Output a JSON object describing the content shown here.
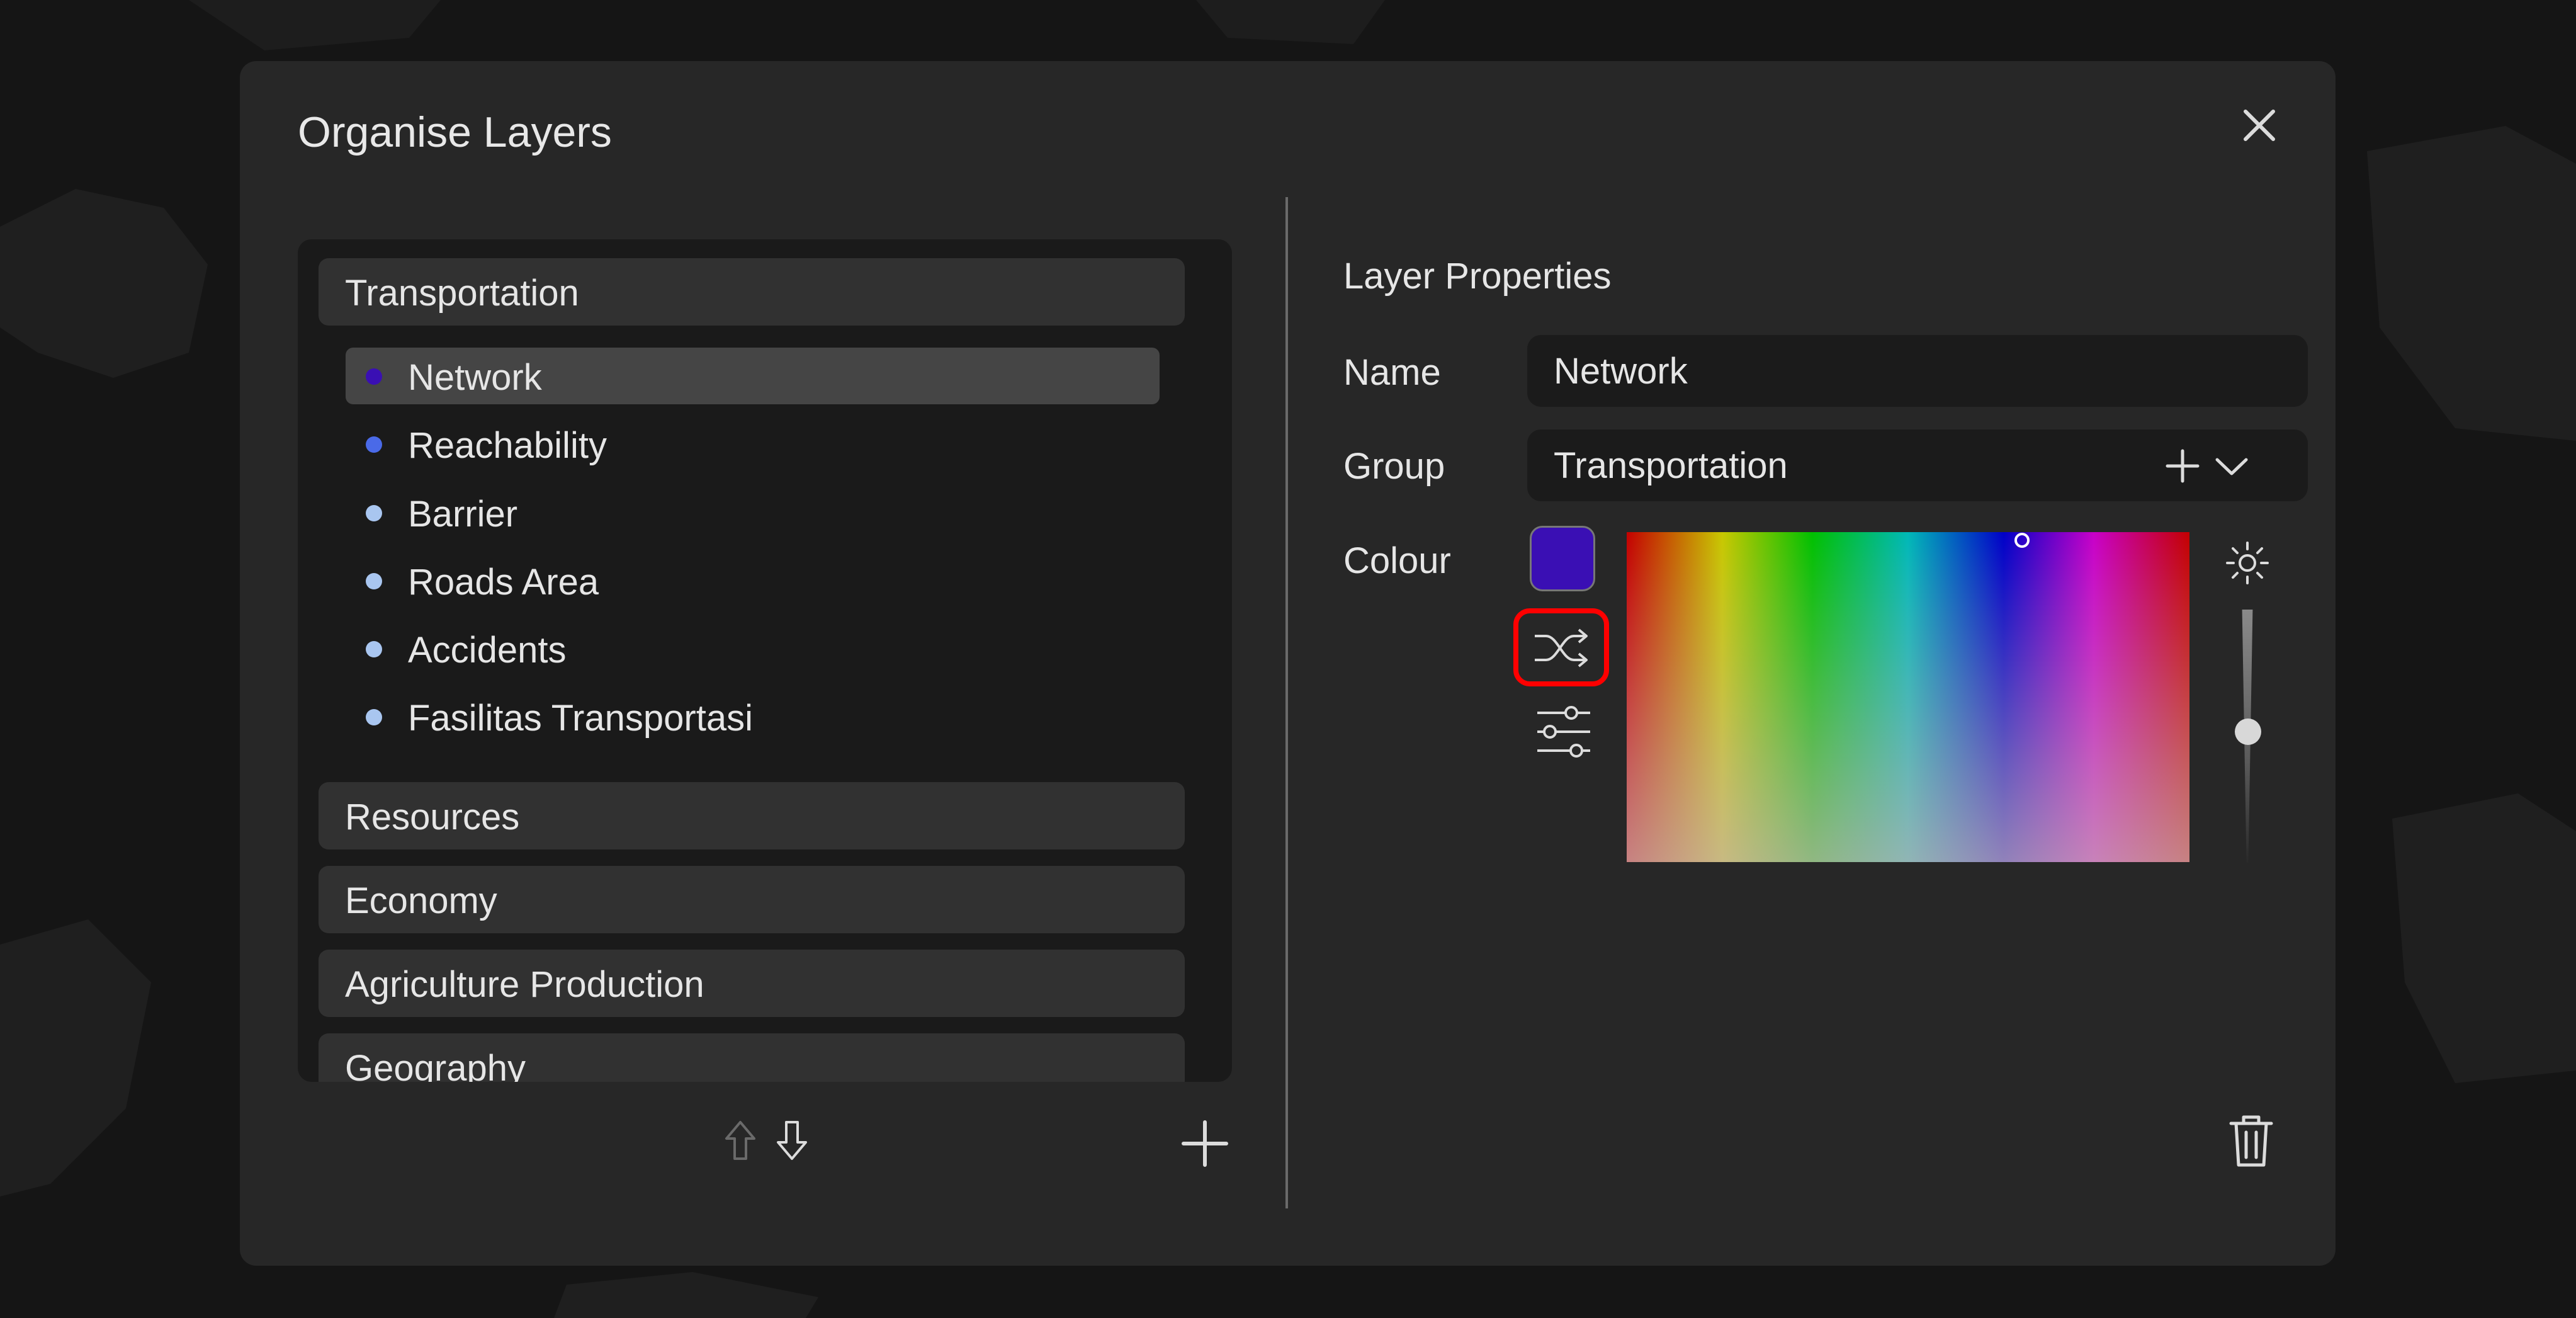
{
  "dialog": {
    "title": "Organise Layers",
    "close_icon": "close-icon"
  },
  "tree": {
    "groups": [
      {
        "label": "Transportation",
        "expanded": true
      },
      {
        "label": "Resources"
      },
      {
        "label": "Economy"
      },
      {
        "label": "Agriculture Production"
      },
      {
        "label": "Geography"
      }
    ],
    "layers": [
      {
        "label": "Network",
        "color": "#3a0fb4",
        "selected": true
      },
      {
        "label": "Reachability",
        "color": "#4a6ae8"
      },
      {
        "label": "Barrier",
        "color": "#a9c6f0"
      },
      {
        "label": "Roads Area",
        "color": "#a9c6f0"
      },
      {
        "label": "Accidents",
        "color": "#a9c6f0"
      },
      {
        "label": "Fasilitas Transportasi",
        "color": "#a9c6f0"
      }
    ]
  },
  "toolbar": {
    "move_up_icon": "arrow-up-icon",
    "move_down_icon": "arrow-down-icon",
    "add_icon": "plus-icon"
  },
  "properties": {
    "section_title": "Layer Properties",
    "name_label": "Name",
    "name_value": "Network",
    "group_label": "Group",
    "group_value": "Transportation",
    "colour_label": "Colour",
    "colour_value": "#3a0fb4",
    "shuffle_icon": "shuffle-icon",
    "sliders_icon": "sliders-icon",
    "brightness_icon": "brightness-icon",
    "delete_icon": "trash-icon",
    "highlight_color": "#ff0000"
  }
}
